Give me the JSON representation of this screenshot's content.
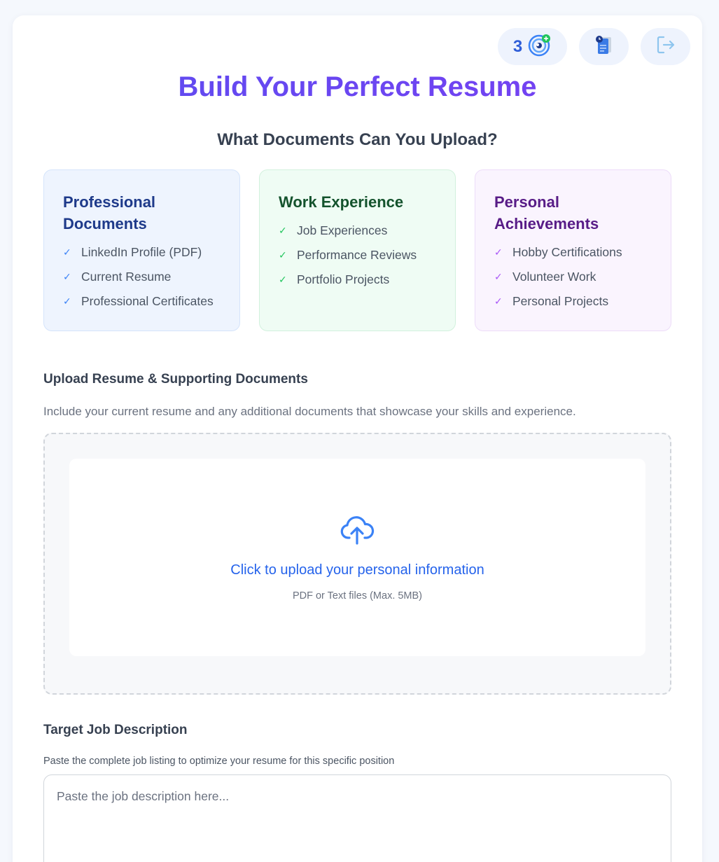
{
  "header": {
    "credits_count": "3",
    "title": "Build Your Perfect Resume",
    "subtitle": "What Documents Can You Upload?"
  },
  "icons": {
    "credits": "target-plus-icon",
    "documents": "document-history-icon",
    "logout": "logout-icon",
    "upload": "cloud-upload-icon",
    "check": "check-icon"
  },
  "categories": [
    {
      "title": "Professional Documents",
      "accent": "#3b82f6",
      "items": [
        "LinkedIn Profile (PDF)",
        "Current Resume",
        "Professional Certificates"
      ]
    },
    {
      "title": "Work Experience",
      "accent": "#22c55e",
      "items": [
        "Job Experiences",
        "Performance Reviews",
        "Portfolio Projects"
      ]
    },
    {
      "title": "Personal Achievements",
      "accent": "#a855f7",
      "items": [
        "Hobby Certifications",
        "Volunteer Work",
        "Personal Projects"
      ]
    }
  ],
  "upload": {
    "label": "Upload Resume & Supporting Documents",
    "help": "Include your current resume and any additional documents that showcase your skills and experience.",
    "cta": "Click to upload your personal information",
    "note": "PDF or Text files (Max. 5MB)"
  },
  "job": {
    "label": "Target Job Description",
    "help": "Paste the complete job listing to optimize your resume for this specific position",
    "placeholder": "Paste the job description here...",
    "value": ""
  },
  "colors": {
    "title_gradient_start": "#5b4df0",
    "title_gradient_end": "#7a3ff2",
    "link_blue": "#2563eb"
  }
}
